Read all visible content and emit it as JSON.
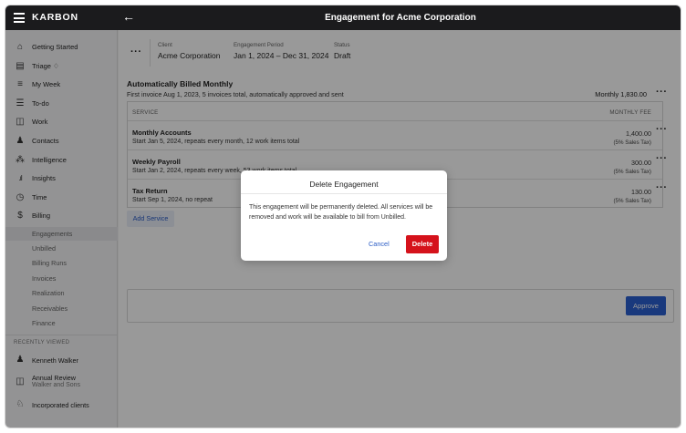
{
  "app": {
    "brand": "KARBON",
    "page_title": "Engagement for Acme Corporation"
  },
  "sidebar": {
    "items": [
      {
        "label": "Getting Started",
        "icon": "home-icon"
      },
      {
        "label": "Triage ♢",
        "icon": "triage-icon"
      },
      {
        "label": "My Week",
        "icon": "list-icon"
      },
      {
        "label": "To-do",
        "icon": "checklist-icon"
      },
      {
        "label": "Work",
        "icon": "briefcase-icon"
      },
      {
        "label": "Contacts",
        "icon": "person-icon"
      },
      {
        "label": "Intelligence",
        "icon": "intelligence-icon"
      },
      {
        "label": "Insights",
        "icon": "bar-chart-icon"
      },
      {
        "label": "Time",
        "icon": "clock-icon"
      },
      {
        "label": "Billing",
        "icon": "dollar-icon"
      }
    ],
    "billing_subitems": [
      "Engagements",
      "Unbilled",
      "Billing Runs",
      "Invoices",
      "Realization",
      "Receivables",
      "Finance"
    ],
    "recently_viewed_label": "RECENTLY VIEWED",
    "recently_viewed": [
      {
        "label": "Kenneth Walker",
        "sublabel": "",
        "icon": "person-icon"
      },
      {
        "label": "Annual Review",
        "sublabel": "Walker and Sons",
        "icon": "briefcase-icon"
      },
      {
        "label": "Incorporated clients",
        "sublabel": "",
        "icon": "group-icon"
      }
    ]
  },
  "engagement": {
    "client_label": "Client",
    "client": "Acme Corporation",
    "period_label": "Engagement Period",
    "period": "Jan 1, 2024 – Dec 31, 2024",
    "status_label": "Status",
    "status": "Draft"
  },
  "billing": {
    "title": "Automatically Billed Monthly",
    "description": "First invoice Aug 1, 2023, 5 invoices total, automatically approved and sent",
    "total": "Monthly 1,830.00",
    "col_service": "SERVICE",
    "col_fee": "MONTHLY FEE",
    "services": [
      {
        "name": "Monthly Accounts",
        "description": "Start Jan 5, 2024, repeats every month, 12 work items total",
        "fee": "1,400.00",
        "tax": "(5% Sales Tax)"
      },
      {
        "name": "Weekly Payroll",
        "description": "Start Jan 2, 2024, repeats every week, 53 work items total",
        "fee": "300.00",
        "tax": "(5% Sales Tax)"
      },
      {
        "name": "Tax Return",
        "description": "Start Sep 1, 2024, no repeat",
        "fee": "130.00",
        "tax": "(5% Sales Tax)"
      }
    ],
    "add_service_label": "Add Service",
    "approve_label": "Approve"
  },
  "modal": {
    "title": "Delete Engagement",
    "body": "This engagement will be permanently deleted. All services will be removed and work will be available to bill from Unbilled.",
    "cancel_label": "Cancel",
    "delete_label": "Delete"
  },
  "colors": {
    "topbar": "#1b1b1d",
    "accent": "#2b5fd1",
    "danger": "#d5121b"
  }
}
